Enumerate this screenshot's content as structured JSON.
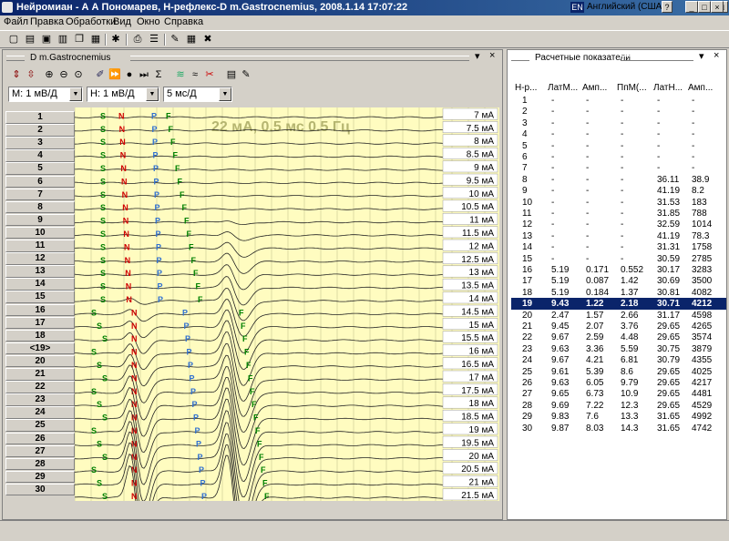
{
  "window": {
    "title": "Нейромиан - А А Пономарев, Н-рефлекс-D  m.Gastrocnemius, 2008.1.14 17:07:22",
    "lang_code": "EN",
    "lang_label": "Английский (США)",
    "help": "?",
    "minimize": "_",
    "maximize": "□",
    "close": "×"
  },
  "menu": [
    "Файл",
    "Правка",
    "Обработки",
    "Вид",
    "Окно",
    "Справка"
  ],
  "toolbar_icons": [
    "new-icon",
    "open-icon",
    "save-icon",
    "print-preview-icon",
    "copy-icon",
    "print-icon",
    "settings-icon",
    "export-icon",
    "edit-icon",
    "tile-icon",
    "layout-icon",
    "delete-icon"
  ],
  "left_panel": {
    "title": "D  m.Gastrocnemius",
    "pin": "▾",
    "close": "×",
    "sens_m": "М: 1 мВ/Д",
    "sens_h": "Н: 1 мВ/Д",
    "sweep": "5 мс/Д",
    "overlay_text": "22 мА, 0.5 мс 0.5 Гц",
    "marker_s": "S",
    "marker_n": "N",
    "marker_f": "F",
    "marker_p": "P",
    "row_labels": [
      "1",
      "2",
      "3",
      "4",
      "5",
      "6",
      "7",
      "8",
      "9",
      "10",
      "11",
      "12",
      "13",
      "14",
      "15",
      "16",
      "17",
      "18",
      "<19>",
      "20",
      "21",
      "22",
      "23",
      "24",
      "25",
      "26",
      "27",
      "28",
      "29",
      "30"
    ],
    "stimuli": [
      "7 мА",
      "7.5 мА",
      "8 мА",
      "8.5 мА",
      "9 мА",
      "9.5 мА",
      "10 мА",
      "10.5 мА",
      "11 мА",
      "11.5 мА",
      "12 мА",
      "12.5 мА",
      "13 мА",
      "13.5 мА",
      "14 мА",
      "14.5 мА",
      "15 мА",
      "15.5 мА",
      "16 мА",
      "16.5 мА",
      "17 мА",
      "17.5 мА",
      "18 мА",
      "18.5 мА",
      "19 мА",
      "19.5 мА",
      "20 мА",
      "20.5 мА",
      "21 мА",
      "21.5 мА"
    ]
  },
  "right_panel": {
    "title": "Расчетные показатели",
    "pin": "▾",
    "close": "×",
    "columns": [
      "Н-р...",
      "ЛатМ...",
      "Амп...",
      "ПпМ(...",
      "ЛатН...",
      "Амп..."
    ],
    "selected_row": "19",
    "rows": [
      [
        "1",
        "-",
        "-",
        "-",
        "-",
        "-"
      ],
      [
        "2",
        "-",
        "-",
        "-",
        "-",
        "-"
      ],
      [
        "3",
        "-",
        "-",
        "-",
        "-",
        "-"
      ],
      [
        "4",
        "-",
        "-",
        "-",
        "-",
        "-"
      ],
      [
        "5",
        "-",
        "-",
        "-",
        "-",
        "-"
      ],
      [
        "6",
        "-",
        "-",
        "-",
        "-",
        "-"
      ],
      [
        "7",
        "-",
        "-",
        "-",
        "-",
        "-"
      ],
      [
        "8",
        "-",
        "-",
        "-",
        "36.11",
        "38.9"
      ],
      [
        "9",
        "-",
        "-",
        "-",
        "41.19",
        "8.2"
      ],
      [
        "10",
        "-",
        "-",
        "-",
        "31.53",
        "183"
      ],
      [
        "11",
        "-",
        "-",
        "-",
        "31.85",
        "788"
      ],
      [
        "12",
        "-",
        "-",
        "-",
        "32.59",
        "1014"
      ],
      [
        "13",
        "-",
        "-",
        "-",
        "41.19",
        "78.3"
      ],
      [
        "14",
        "-",
        "-",
        "-",
        "31.31",
        "1758"
      ],
      [
        "15",
        "-",
        "-",
        "-",
        "30.59",
        "2785"
      ],
      [
        "16",
        "5.19",
        "0.171",
        "0.552",
        "30.17",
        "3283"
      ],
      [
        "17",
        "5.19",
        "0.087",
        "1.42",
        "30.69",
        "3500"
      ],
      [
        "18",
        "5.19",
        "0.184",
        "1.37",
        "30.81",
        "4082"
      ],
      [
        "19",
        "9.43",
        "1.22",
        "2.18",
        "30.71",
        "4212"
      ],
      [
        "20",
        "2.47",
        "1.57",
        "2.66",
        "31.17",
        "4598"
      ],
      [
        "21",
        "9.45",
        "2.07",
        "3.76",
        "29.65",
        "4265"
      ],
      [
        "22",
        "9.67",
        "2.59",
        "4.48",
        "29.65",
        "3574"
      ],
      [
        "23",
        "9.63",
        "3.36",
        "5.59",
        "30.75",
        "3879"
      ],
      [
        "24",
        "9.67",
        "4.21",
        "6.81",
        "30.79",
        "4355"
      ],
      [
        "25",
        "9.61",
        "5.39",
        "8.6",
        "29.65",
        "4025"
      ],
      [
        "26",
        "9.63",
        "6.05",
        "9.79",
        "29.65",
        "4217"
      ],
      [
        "27",
        "9.65",
        "6.73",
        "10.9",
        "29.65",
        "4481"
      ],
      [
        "28",
        "9.69",
        "7.22",
        "12.3",
        "29.65",
        "4529"
      ],
      [
        "29",
        "9.83",
        "7.6",
        "13.3",
        "31.65",
        "4992"
      ],
      [
        "30",
        "9.87",
        "8.03",
        "14.3",
        "31.65",
        "4742"
      ]
    ]
  },
  "colors": {
    "title_from": "#0a246a",
    "title_to": "#3a6ea5",
    "plot_bg": "#fffcc0",
    "selection": "#0a246a",
    "marker_s": "#008000",
    "marker_n": "#d00000",
    "marker_f": "#008000",
    "marker_p": "#3070d0"
  }
}
